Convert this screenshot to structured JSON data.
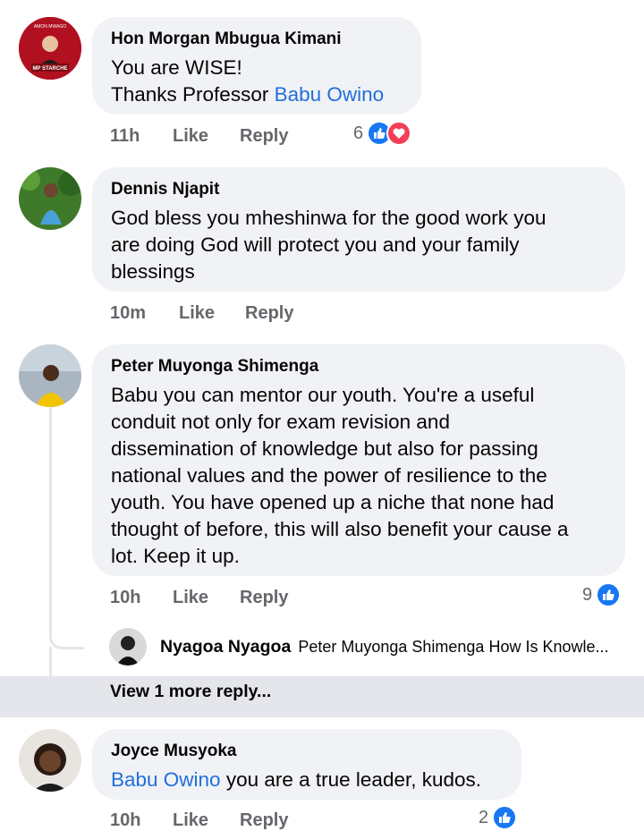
{
  "comments": [
    {
      "author": "Hon Morgan Mbugua Kimani",
      "avatar_text_top": "AMON MWAGO",
      "avatar_text_bottom": "MP STARCHE",
      "line1": "You are WISE!",
      "line2_prefix": "Thanks Professor ",
      "line2_mention": "Babu Owino",
      "time": "11h",
      "like_label": "Like",
      "reply_label": "Reply",
      "reaction_count": "6",
      "reactions": [
        "like-icon",
        "love-icon"
      ]
    },
    {
      "author": "Dennis Njapit",
      "lines": [
        "God bless you mheshinwa for the good work you",
        "are doing God will protect you and your family",
        "blessings"
      ],
      "time": "10m",
      "like_label": "Like",
      "reply_label": "Reply"
    },
    {
      "author": "Peter Muyonga Shimenga",
      "lines": [
        "Babu you can mentor our youth. You're a useful",
        "conduit not only for exam revision and",
        "dissemination of knowledge but also for passing",
        "national values and the power of resilience to the",
        "youth. You have opened up a niche that none had",
        "thought of before, this will also benefit your cause a",
        "lot. Keep it up."
      ],
      "time": "10h",
      "like_label": "Like",
      "reply_label": "Reply",
      "reaction_count": "9",
      "reactions": [
        "like-icon"
      ],
      "reply_preview": {
        "author": "Nyagoa Nyagoa",
        "text": "Peter Muyonga Shimenga How Is Knowle..."
      },
      "view_more": "View 1 more reply..."
    },
    {
      "author": "Joyce Musyoka",
      "mention": "Babu Owino",
      "text_suffix": " you are a true leader, kudos.",
      "time": "10h",
      "like_label": "Like",
      "reply_label": "Reply",
      "reaction_count": "2",
      "reactions": [
        "like-icon"
      ]
    }
  ],
  "colors": {
    "bubble": "#f0f2f5",
    "mention": "#216fdb",
    "meta": "#65676b",
    "like": "#1877f2",
    "love": "#f33e58",
    "reply_bar": "#e4e6eb"
  }
}
